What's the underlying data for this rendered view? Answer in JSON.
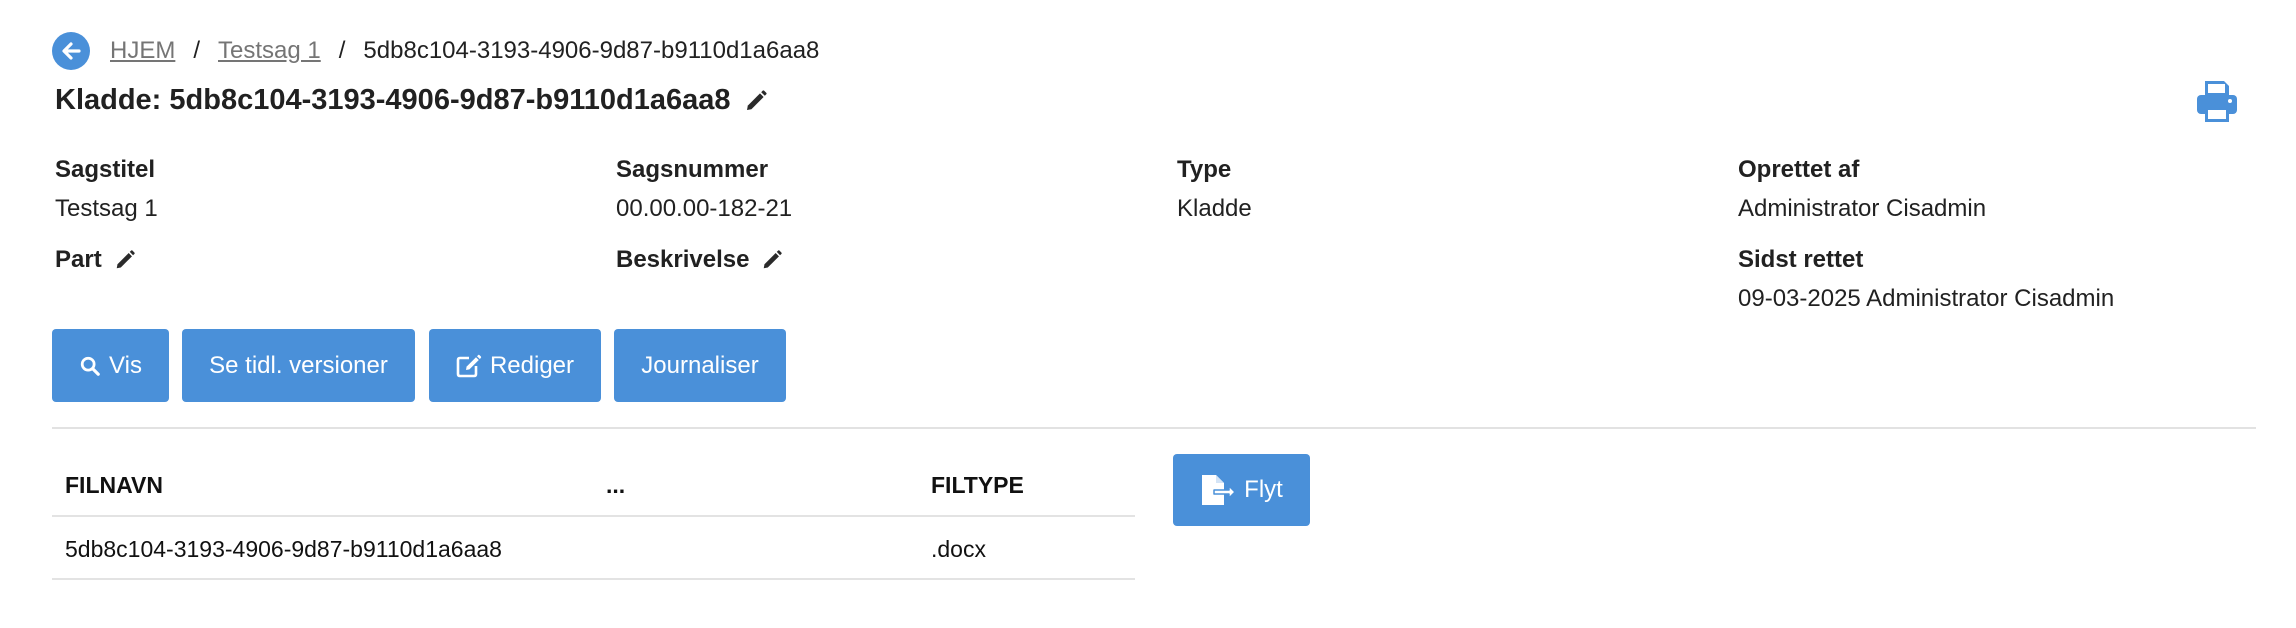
{
  "breadcrumb": {
    "home": "HJEM",
    "case": "Testsag 1",
    "separator": "/",
    "current": "5db8c104-3193-4906-9d87-b9110d1a6aa8"
  },
  "title": "Kladde: 5db8c104-3193-4906-9d87-b9110d1a6aa8",
  "meta": {
    "sagstitel_label": "Sagstitel",
    "sagstitel_value": "Testsag 1",
    "sagsnummer_label": "Sagsnummer",
    "sagsnummer_value": "00.00.00-182-21",
    "type_label": "Type",
    "type_value": "Kladde",
    "oprettet_label": "Oprettet af",
    "oprettet_value": "Administrator Cisadmin",
    "part_label": "Part",
    "beskrivelse_label": "Beskrivelse",
    "sidst_label": "Sidst rettet",
    "sidst_value": "09-03-2025 Administrator Cisadmin"
  },
  "buttons": {
    "vis": "Vis",
    "versions": "Se tidl. versioner",
    "rediger": "Rediger",
    "journaliser": "Journaliser",
    "flyt": "Flyt"
  },
  "table": {
    "headers": [
      "FILNAVN",
      "...",
      "FILTYPE"
    ],
    "rows": [
      {
        "filnavn": "5db8c104-3193-4906-9d87-b9110d1a6aa8",
        "extra": "",
        "filtype": ".docx"
      }
    ]
  },
  "colors": {
    "accent": "#4a90d9",
    "text": "#212121",
    "muted": "#757575"
  },
  "icons": [
    "back-arrow-icon",
    "pencil-icon",
    "print-icon",
    "search-icon",
    "edit-icon",
    "file-export-icon"
  ]
}
